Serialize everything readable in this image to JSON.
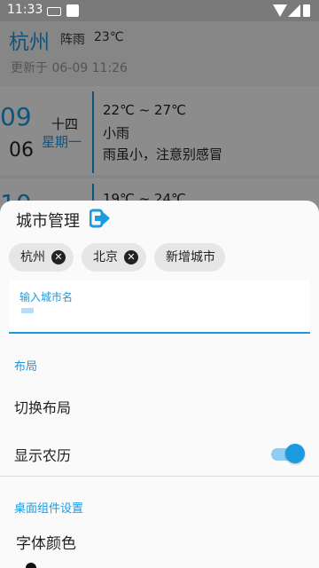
{
  "status_bar": {
    "time": "11:33"
  },
  "weather": {
    "city": "杭州",
    "condition": "阵雨",
    "temperature": "23℃",
    "updated": "更新于 06-09 11:26",
    "today": {
      "day": "09",
      "month": "06",
      "lunar": "十四",
      "weekday": "星期一",
      "range": "22℃ ~ 27℃",
      "desc": "小雨",
      "tip": "雨虽小，注意别感冒"
    },
    "next": {
      "range": "19℃ ~ 24℃"
    }
  },
  "sheet": {
    "title": "城市管理",
    "chips": [
      {
        "label": "杭州",
        "removable": true
      },
      {
        "label": "北京",
        "removable": true
      },
      {
        "label": "新增城市",
        "removable": false
      }
    ],
    "input": {
      "label": "输入城市名",
      "value": ""
    },
    "layout_section": "布局",
    "switch_layout": "切换布局",
    "show_lunar": "显示农历",
    "show_lunar_on": true,
    "widget_section": "桌面组件设置",
    "font_color": "字体颜色"
  },
  "colors": {
    "accent": "#1a9be0",
    "chip_bg": "#e6e6e6"
  }
}
